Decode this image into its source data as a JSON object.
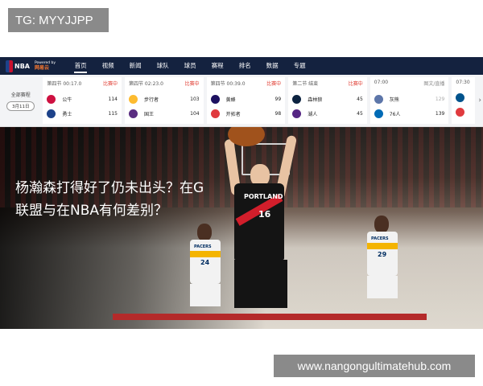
{
  "watermark": {
    "tg": "TG: MYYJJPP",
    "site": "www.nangongultimatehub.com"
  },
  "nav": {
    "logo_text": "NBA",
    "powered_by": "Powered by",
    "powered_brand": "网易云",
    "items": [
      {
        "label": "首页",
        "active": true
      },
      {
        "label": "视频"
      },
      {
        "label": "新闻"
      },
      {
        "label": "球队"
      },
      {
        "label": "球员"
      },
      {
        "label": "赛程"
      },
      {
        "label": "排名"
      },
      {
        "label": "数据"
      },
      {
        "label": "专题"
      }
    ]
  },
  "schedule": {
    "label": "全部赛程",
    "date": "3月11日",
    "games": [
      {
        "period": "第四节 00:17.0",
        "status": "比赛中",
        "home": {
          "team": "公牛",
          "score": "114",
          "color": "#ce1141"
        },
        "away": {
          "team": "勇士",
          "score": "115",
          "color": "#1d428a"
        }
      },
      {
        "period": "第四节 02:23.0",
        "status": "比赛中",
        "home": {
          "team": "步行者",
          "score": "103",
          "color": "#fdbb30"
        },
        "away": {
          "team": "国王",
          "score": "104",
          "color": "#5a2d81"
        }
      },
      {
        "period": "第四节 00:39.0",
        "status": "比赛中",
        "home": {
          "team": "黄蜂",
          "score": "99",
          "color": "#1d1160"
        },
        "away": {
          "team": "开拓者",
          "score": "98",
          "color": "#e03a3e"
        }
      },
      {
        "period": "第二节 结束",
        "status": "比赛中",
        "home": {
          "team": "森林狼",
          "score": "45",
          "color": "#0c2340"
        },
        "away": {
          "team": "湖人",
          "score": "45",
          "color": "#552583"
        }
      },
      {
        "period": "07:00",
        "status": "图文/直播",
        "home": {
          "team": "灰熊",
          "score": "129",
          "color": "#5d76a9"
        },
        "away": {
          "team": "76人",
          "score": "139",
          "color": "#006bb6"
        }
      },
      {
        "period": "07:30",
        "status": "",
        "home": {
          "team": "",
          "score": "",
          "color": "#00538c"
        },
        "away": {
          "team": "",
          "score": "",
          "color": "#e03a3e"
        }
      }
    ]
  },
  "hero": {
    "headline": "杨瀚森打得好了仍未出头？在G联盟与在NBA有何差别？",
    "main_player": {
      "team": "PORTLAND",
      "number": "16"
    },
    "pacers_a": {
      "team": "PACERS",
      "number": "24"
    },
    "pacers_b": {
      "team": "PACERS",
      "number": "29"
    }
  }
}
